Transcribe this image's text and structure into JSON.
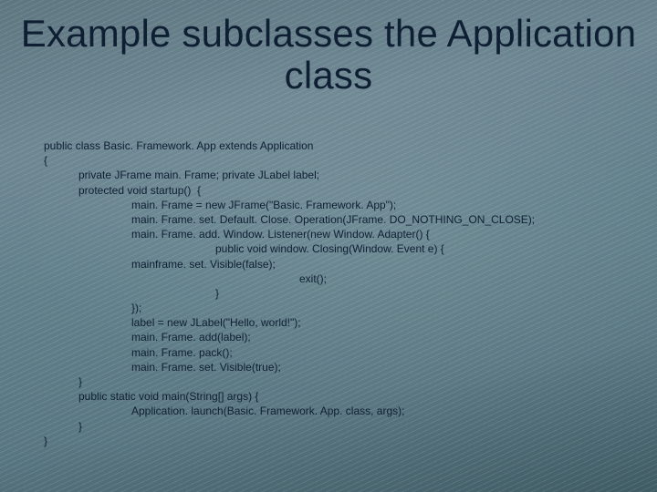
{
  "title": "Example subclasses the Application class",
  "code": {
    "l0": "public class Basic. Framework. App extends Application",
    "l1": "{",
    "l2": "private JFrame main. Frame; private JLabel label;",
    "l3": "protected void startup()  {",
    "l4": "main. Frame = new JFrame(\"Basic. Framework. App\");",
    "l5": "main. Frame. set. Default. Close. Operation(JFrame. DO_NOTHING_ON_CLOSE);",
    "l6": "main. Frame. add. Window. Listener(new Window. Adapter() {",
    "l7": "public void window. Closing(Window. Event e) {",
    "l8": "mainframe. set. Visible(false);",
    "l9": "exit();",
    "l10": "}",
    "l11": "});",
    "l12": "label = new JLabel(\"Hello, world!\");",
    "l13": "main. Frame. add(label);",
    "l14": "main. Frame. pack();",
    "l15": "main. Frame. set. Visible(true);",
    "l16": "}",
    "l17": "public static void main(String[] args) {",
    "l18": "Application. launch(Basic. Framework. App. class, args);",
    "l19": "}",
    "l20": "}"
  }
}
